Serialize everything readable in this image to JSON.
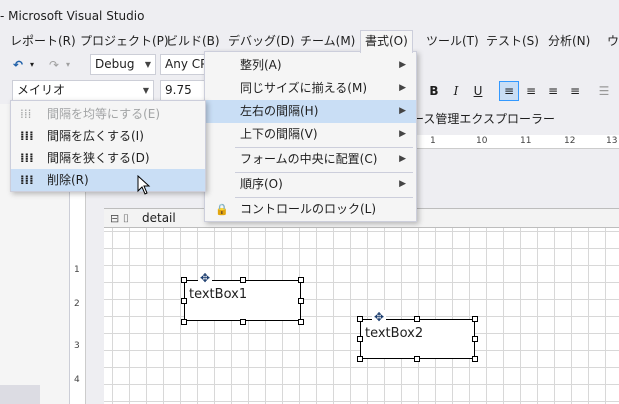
{
  "window": {
    "title": "- Microsoft Visual Studio"
  },
  "menubar": {
    "items": [
      "レポート(R)",
      "プロジェクト(P)",
      "ビルド(B)",
      "デバッグ(D)",
      "チーム(M)",
      "書式(O)",
      "ツール(T)",
      "テスト(S)",
      "分析(N)",
      "ウ"
    ]
  },
  "toolbar": {
    "config": "Debug",
    "platform": "Any CP",
    "font_name": "メイリオ",
    "font_size": "9.75",
    "bold": "B",
    "italic": "I",
    "underline": "U"
  },
  "format_menu": {
    "items": [
      {
        "label": "整列(A)",
        "submenu": true
      },
      {
        "label": "同じサイズに揃える(M)",
        "submenu": true
      },
      {
        "label": "左右の間隔(H)",
        "submenu": true,
        "highlighted": true
      },
      {
        "label": "上下の間隔(V)",
        "submenu": true
      },
      {
        "label": "フォームの中央に配置(C)",
        "submenu": true
      },
      {
        "label": "順序(O)",
        "submenu": true
      },
      {
        "label": "コントロールのロック(L)",
        "submenu": false
      }
    ]
  },
  "spacing_submenu": {
    "items": [
      {
        "label": "間隔を均等にする(E)",
        "enabled": false
      },
      {
        "label": "間隔を広くする(I)",
        "enabled": true
      },
      {
        "label": "間隔を狭くする(D)",
        "enabled": true
      },
      {
        "label": "削除(R)",
        "enabled": true,
        "highlighted": true
      }
    ]
  },
  "tab": {
    "label": "ース管理エクスプローラー"
  },
  "ruler": {
    "h": [
      "1",
      "10",
      "11",
      "12",
      "13"
    ],
    "v": [
      "1",
      "2",
      "3",
      "4"
    ]
  },
  "report": {
    "section": "detail",
    "textboxes": [
      "textBox1",
      "textBox2"
    ]
  }
}
